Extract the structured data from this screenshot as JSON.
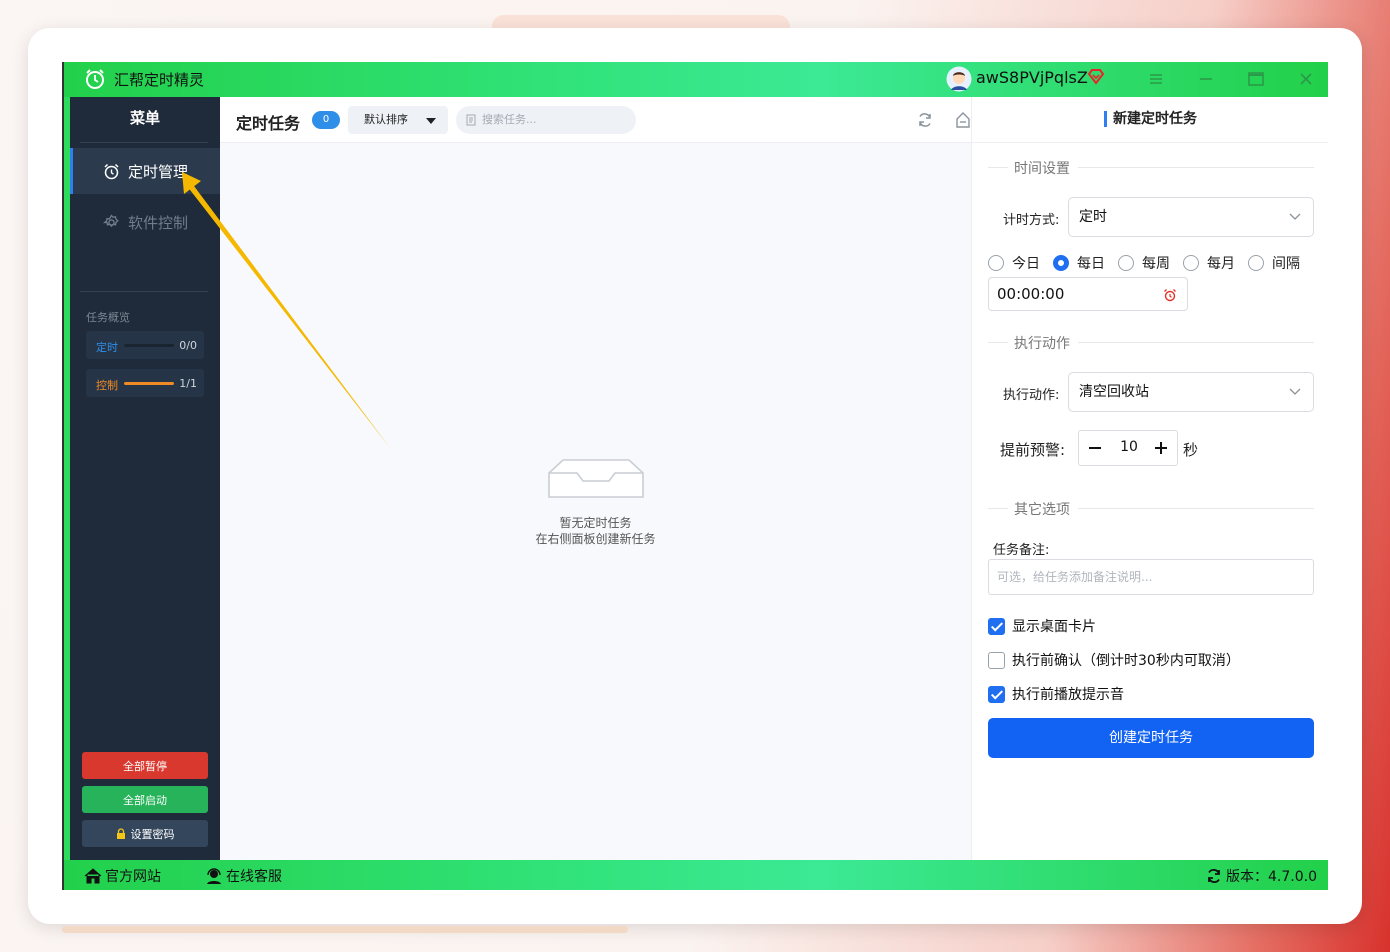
{
  "app": {
    "title": "汇帮定时精灵",
    "username": "awS8PVjPqlsZ"
  },
  "sidebar": {
    "menu_title": "菜单",
    "items": [
      {
        "label": "定时管理",
        "active": true
      },
      {
        "label": "软件控制",
        "active": false
      }
    ],
    "overview": {
      "label": "任务概览",
      "rows": [
        {
          "name": "定时",
          "value": "0/0",
          "progress": 0,
          "color": "#2f8ee8"
        },
        {
          "name": "控制",
          "value": "1/1",
          "progress": 1,
          "color": "#f08a24"
        }
      ]
    },
    "buttons": {
      "pause_all": "全部暂停",
      "start_all": "全部启动",
      "set_password": "设置密码"
    }
  },
  "main": {
    "title": "定时任务",
    "count": "0",
    "sort_label": "默认排序",
    "search_placeholder": "搜索任务...",
    "empty_line1": "暂无定时任务",
    "empty_line2": "在右侧面板创建新任务"
  },
  "panel": {
    "title": "新建定时任务",
    "section_time": "时间设置",
    "timing_mode_label": "计时方式:",
    "timing_mode_value": "定时",
    "frequency_options": [
      "今日",
      "每日",
      "每周",
      "每月",
      "间隔"
    ],
    "frequency_selected": "每日",
    "time_value": "00:00:00",
    "section_action": "执行动作",
    "action_label": "执行动作:",
    "action_value": "清空回收站",
    "warning_label": "提前预警:",
    "warning_value": "10",
    "warning_unit": "秒",
    "section_other": "其它选项",
    "note_label": "任务备注:",
    "note_placeholder": "可选，给任务添加备注说明...",
    "options": [
      {
        "label": "显示桌面卡片",
        "checked": true
      },
      {
        "label": "执行前确认（倒计时30秒内可取消）",
        "checked": false
      },
      {
        "label": "执行前播放提示音",
        "checked": true
      }
    ],
    "create_button": "创建定时任务"
  },
  "footer": {
    "website": "官方网站",
    "support": "在线客服",
    "version": "版本：4.7.0.0"
  },
  "colors": {
    "accent": "#1263f4",
    "titlebar": "#31e37a",
    "sidebar": "#1f2a3a",
    "pause": "#d8382e",
    "start": "#27b35a",
    "arrow": "#f5b800"
  }
}
